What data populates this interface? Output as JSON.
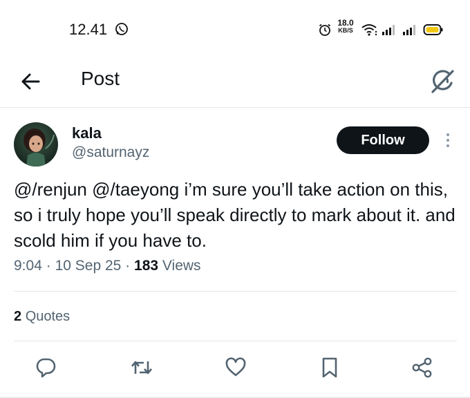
{
  "status_bar": {
    "time": "12.41",
    "net_speed_value": "18.0",
    "net_speed_unit": "KB/S",
    "icons": [
      "whatsapp-icon",
      "alarm-icon",
      "wifi-icon",
      "signal-icon",
      "signal-icon",
      "battery-icon"
    ],
    "battery_color": "#f2c811"
  },
  "header": {
    "title": "Post",
    "back_icon": "back-arrow-icon",
    "grok_icon": "grok-icon"
  },
  "post": {
    "author": {
      "name": "kala",
      "handle": "@saturnayz",
      "avatar": "avatar"
    },
    "follow_label": "Follow",
    "text": "@/renjun @/taeyong i’m sure you’ll take action on this, so i truly hope you’ll speak directly to mark about it. and scold him if you have to.",
    "time": "9:04",
    "date": "10 Sep 25",
    "views_count": "183",
    "views_label": "Views",
    "separator": "·",
    "quotes_count": "2",
    "quotes_label": "Quotes"
  },
  "actions": [
    "reply-icon",
    "repost-icon",
    "like-icon",
    "bookmark-icon",
    "share-icon"
  ],
  "colors": {
    "text_primary": "#0f1419",
    "text_secondary": "#536471",
    "follow_bg": "#0f1419",
    "follow_text": "#ffffff",
    "divider": "#e3e6e8"
  }
}
